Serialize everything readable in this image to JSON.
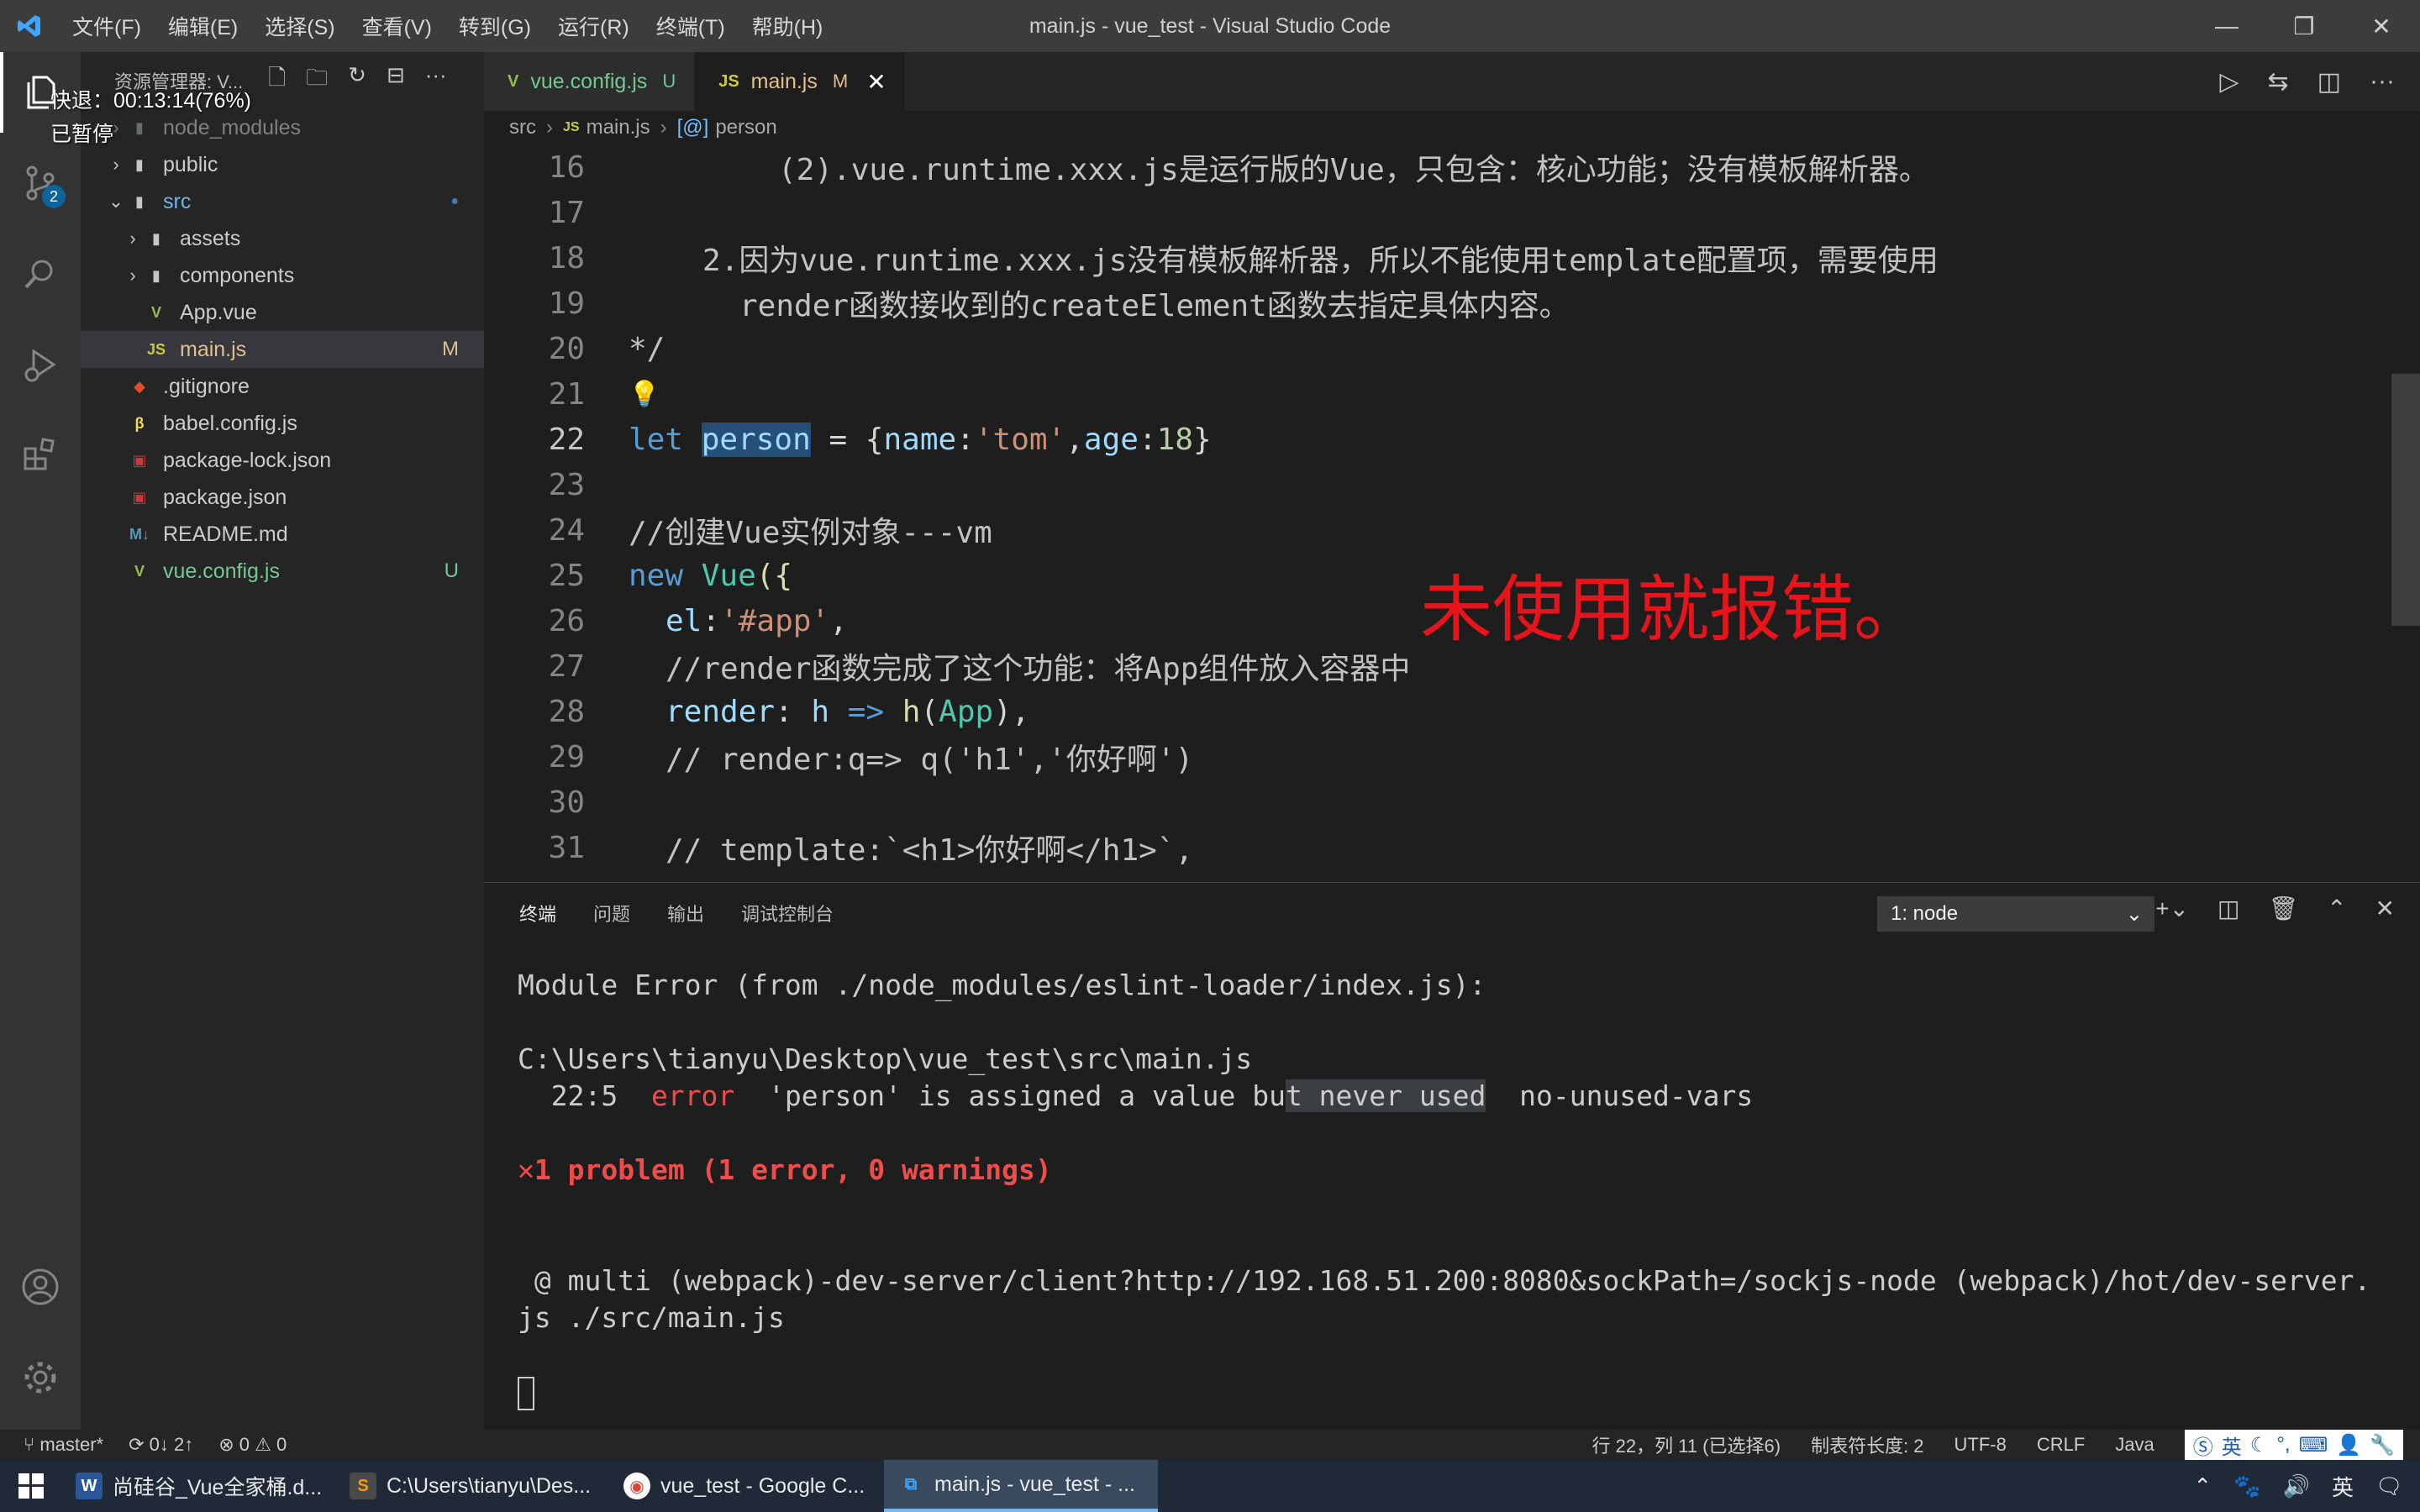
{
  "window": {
    "title": "main.js - vue_test - Visual Studio Code",
    "menu": [
      "文件(F)",
      "编辑(E)",
      "选择(S)",
      "查看(V)",
      "转到(G)",
      "运行(R)",
      "终端(T)",
      "帮助(H)"
    ]
  },
  "overlay": {
    "speed": "快退：00:13:14(76%)",
    "paused": "已暂停"
  },
  "activity": {
    "scm_badge": "2"
  },
  "sidebar": {
    "header": "资源管理器: V...",
    "tree": [
      {
        "label": "node_modules",
        "status": ""
      },
      {
        "label": "public",
        "status": ""
      },
      {
        "label": "src",
        "status": "●"
      },
      {
        "label": "assets",
        "status": ""
      },
      {
        "label": "components",
        "status": ""
      },
      {
        "label": "App.vue",
        "status": ""
      },
      {
        "label": "main.js",
        "status": "M"
      },
      {
        "label": ".gitignore",
        "status": ""
      },
      {
        "label": "babel.config.js",
        "status": ""
      },
      {
        "label": "package-lock.json",
        "status": ""
      },
      {
        "label": "package.json",
        "status": ""
      },
      {
        "label": "README.md",
        "status": ""
      },
      {
        "label": "vue.config.js",
        "status": "U"
      }
    ]
  },
  "tabs": [
    {
      "label": "vue.config.js",
      "status": "U"
    },
    {
      "label": "main.js",
      "status": "M"
    }
  ],
  "breadcrumb": [
    "src",
    "main.js",
    "person"
  ],
  "code": {
    "line_numbers": [
      "16",
      "17",
      "18",
      "19",
      "20",
      "21",
      "22",
      "23",
      "24",
      "25",
      "26",
      "27",
      "28",
      "29",
      "30",
      "31"
    ],
    "l16": "(2).vue.runtime.xxx.js是运行版的Vue，只包含：核心功能；没有模板解析器。",
    "l18": "2.因为vue.runtime.xxx.js没有模板解析器，所以不能使用template配置项，需要使用",
    "l19": "render函数接收到的createElement函数去指定具体内容。",
    "l20": "*/",
    "l22_let": "let",
    "l22_var": "person",
    "l22_eq": " = {",
    "l22_k1": "name",
    "l22_c1": ":",
    "l22_s1": "'tom'",
    "l22_cm": ",",
    "l22_k2": "age",
    "l22_c2": ":",
    "l22_n": "18",
    "l22_end": "}",
    "l24": "//创建Vue实例对象---vm",
    "l25_new": "new",
    "l25_cls": "Vue",
    "l25_end": "({",
    "l26_k": "el",
    "l26_c": ":",
    "l26_s": "'#app'",
    "l26_e": ",",
    "l27": "//render函数完成了这个功能：将App组件放入容器中",
    "l28_k": "render",
    "l28_c": ": ",
    "l28_h": "h",
    "l28_arrow": " => ",
    "l28_fn": "h",
    "l28_p": "(",
    "l28_app": "App",
    "l28_e": "),",
    "l29": "// render:q=> q('h1','你好啊')",
    "l31": "// template:`<h1>你好啊</h1>`,"
  },
  "annotation": "未使用就报错。",
  "panel": {
    "tabs": [
      "终端",
      "问题",
      "输出",
      "调试控制台"
    ],
    "terminal_select": "1: node",
    "terminal": {
      "t1": "Module Error (from ./node_modules/eslint-loader/index.js):",
      "t2": "C:\\Users\\tianyu\\Desktop\\vue_test\\src\\main.js",
      "t3_pos": "  22:5  ",
      "t3_err": "error",
      "t3_msg_a": "  'person' is assigned a value bu",
      "t3_msg_sel": "t never used",
      "t3_rule": "  no-unused-vars",
      "t4_x": "✕",
      "t4": "1 problem (1 error, 0 warnings)",
      "t5": " @ multi (webpack)-dev-server/client?http://192.168.51.200:8080&sockPath=/sockjs-node (webpack)/hot/dev-server.",
      "t6": "js ./src/main.js"
    }
  },
  "status": {
    "branch": "master*",
    "sync": "0↓ 2↑",
    "problems": "⊗ 0 ⚠ 0",
    "position": "行 22，列 11 (已选择6)",
    "indent": "制表符长度: 2",
    "encoding": "UTF-8",
    "eol": "CRLF",
    "lang": "Java",
    "ime": "英"
  },
  "taskbar": {
    "items": [
      {
        "label": "尚硅谷_Vue全家桶.d..."
      },
      {
        "label": "C:\\Users\\tianyu\\Des..."
      },
      {
        "label": "vue_test - Google C..."
      },
      {
        "label": "main.js - vue_test - ..."
      }
    ],
    "ime": "英"
  }
}
